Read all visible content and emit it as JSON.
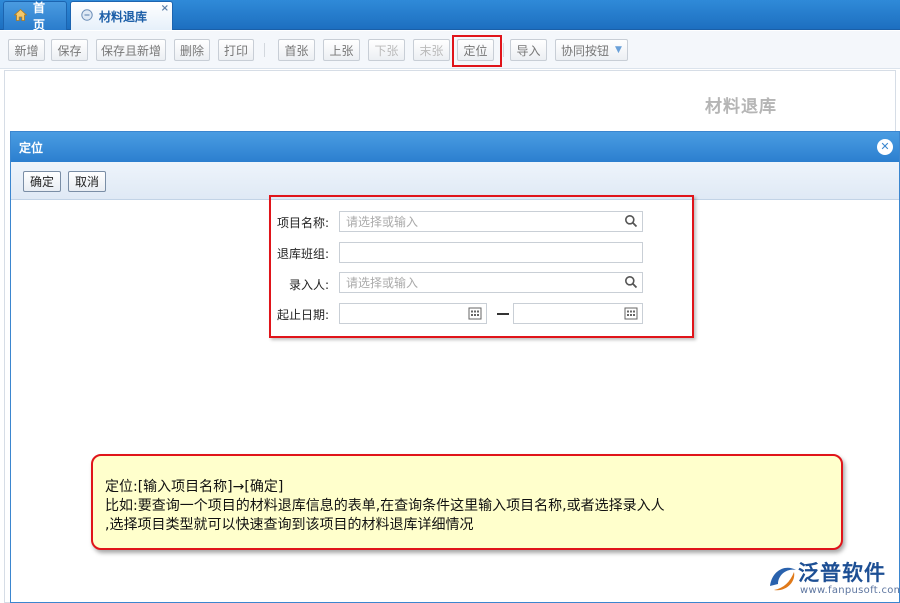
{
  "tabs": [
    {
      "label": "首页",
      "icon": "home-icon"
    },
    {
      "label": "材料退库",
      "icon": "doc-circle-icon",
      "close": "×"
    }
  ],
  "toolbar": {
    "buttons": [
      {
        "label": "新增"
      },
      {
        "label": "保存"
      },
      {
        "label": "保存且新增"
      },
      {
        "label": "删除"
      },
      {
        "label": "打印"
      },
      {
        "label": "首张"
      },
      {
        "label": "上张"
      },
      {
        "label": "下张"
      },
      {
        "label": "末张"
      },
      {
        "label": "定位"
      },
      {
        "label": "导入"
      },
      {
        "label": "协同按钮"
      }
    ]
  },
  "page": {
    "title": "材料退库"
  },
  "dialog": {
    "title": "定位",
    "confirm_label": "确定",
    "cancel_label": "取消",
    "fields": {
      "project_name": {
        "label": "项目名称:",
        "placeholder": "请选择或输入"
      },
      "return_team": {
        "label": "退库班组:",
        "placeholder": ""
      },
      "entered_by": {
        "label": "录入人:",
        "placeholder": "请选择或输入"
      },
      "date_range": {
        "label": "起止日期:",
        "separator": "—"
      }
    }
  },
  "callout": {
    "line1": "定位:[输入项目名称]→[确定]",
    "line2": "比如:要查询一个项目的材料退库信息的表单,在查询条件这里输入项目名称,或者选择录入人",
    "line3": ",选择项目类型就可以快速查询到该项目的材料退库详细情况"
  },
  "watermark": {
    "name": "泛普软件",
    "url": "www.fanpusoft.com"
  },
  "colors": {
    "accent": "#2c7fcf",
    "highlight": "#e0141a",
    "callout_bg": "#ffffcc"
  }
}
